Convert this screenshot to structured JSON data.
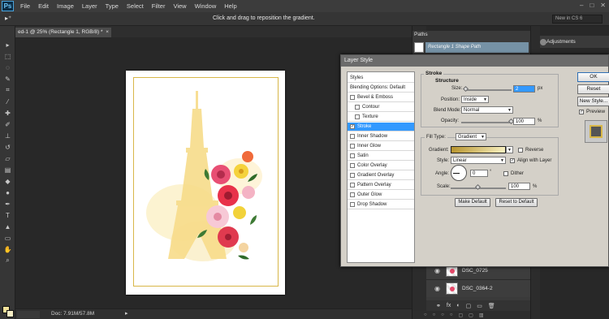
{
  "app": {
    "logo": "Ps"
  },
  "menu": [
    "File",
    "Edit",
    "Image",
    "Layer",
    "Type",
    "Select",
    "Filter",
    "View",
    "Window",
    "Help"
  ],
  "window_controls": [
    "–",
    "□",
    "✕"
  ],
  "options_bar": {
    "tool_icon": "move-arrow-icon",
    "tool_glyph": "▸⁺",
    "hint": "Click and drag to reposition the gradient.",
    "workspace": "New in CS 6"
  },
  "document": {
    "tab_title": "ed-1 @ 25% (Rectangle 1, RGB/8) *",
    "tab_close": "×",
    "doc_size": "Doc: 7.91M/57.8M",
    "status_arrow": "▸"
  },
  "colors": {
    "foreground": "#f3e29a",
    "background": "#f6edc4",
    "gradient_from": "#b8952e",
    "gradient_to": "#f8f0c0",
    "frame_gold": "#d8b749",
    "selected_style": "#3399ff"
  },
  "paths_panel": {
    "tab": "Paths",
    "path_name": "Rectangle 1 Shape Path"
  },
  "adjustments_panel": {
    "title": "Adjustments"
  },
  "layers_panel": {
    "layers": [
      {
        "name": "DSC_0725",
        "eye": "◉"
      },
      {
        "name": "DSC_0364-2",
        "eye": "◉"
      }
    ],
    "footer_icons": [
      "⚭",
      "fx",
      "◐",
      "▢",
      "▭",
      "🗑"
    ]
  },
  "dialog": {
    "title": "Layer Style",
    "styles_header": "Styles",
    "blending_options": "Blending Options: Default",
    "styles": [
      {
        "label": "Bevel & Emboss",
        "checked": false,
        "sub": false,
        "selected": false
      },
      {
        "label": "Contour",
        "checked": false,
        "sub": true,
        "selected": false
      },
      {
        "label": "Texture",
        "checked": false,
        "sub": true,
        "selected": false
      },
      {
        "label": "Stroke",
        "checked": true,
        "sub": false,
        "selected": true
      },
      {
        "label": "Inner Shadow",
        "checked": false,
        "sub": false,
        "selected": false
      },
      {
        "label": "Inner Glow",
        "checked": false,
        "sub": false,
        "selected": false
      },
      {
        "label": "Satin",
        "checked": false,
        "sub": false,
        "selected": false
      },
      {
        "label": "Color Overlay",
        "checked": false,
        "sub": false,
        "selected": false
      },
      {
        "label": "Gradient Overlay",
        "checked": false,
        "sub": false,
        "selected": false
      },
      {
        "label": "Pattern Overlay",
        "checked": false,
        "sub": false,
        "selected": false
      },
      {
        "label": "Outer Glow",
        "checked": false,
        "sub": false,
        "selected": false
      },
      {
        "label": "Drop Shadow",
        "checked": false,
        "sub": false,
        "selected": false
      }
    ],
    "check_mark": "✓",
    "stroke": {
      "group_title": "Stroke",
      "structure_title": "Structure",
      "size_label": "Size:",
      "size_value": "2",
      "size_unit": "px",
      "size_fraction": 0.04,
      "position_label": "Position:",
      "position_value": "Inside",
      "blend_mode_label": "Blend Mode:",
      "blend_mode_value": "Normal",
      "opacity_label": "Opacity:",
      "opacity_value": "100",
      "opacity_unit": "%",
      "opacity_fraction": 1.0
    },
    "fill": {
      "fill_type_label": "Fill Type:",
      "fill_type_value": "Gradient",
      "gradient_label": "Gradient:",
      "reverse_label": "Reverse",
      "reverse_checked": false,
      "style_label": "Style:",
      "style_value": "Linear",
      "align_label": "Align with Layer",
      "align_checked": true,
      "angle_label": "Angle:",
      "angle_value": "0",
      "angle_unit": "°",
      "dither_label": "Dither",
      "dither_checked": false,
      "scale_label": "Scale:",
      "scale_value": "100",
      "scale_unit": "%",
      "scale_fraction": 0.5
    },
    "make_default": "Make Default",
    "reset_default": "Reset to Default",
    "ok": "OK",
    "reset": "Reset",
    "new_style": "New Style...",
    "preview_label": "Preview",
    "preview_checked": true,
    "dropdown_arrow": "▼"
  }
}
